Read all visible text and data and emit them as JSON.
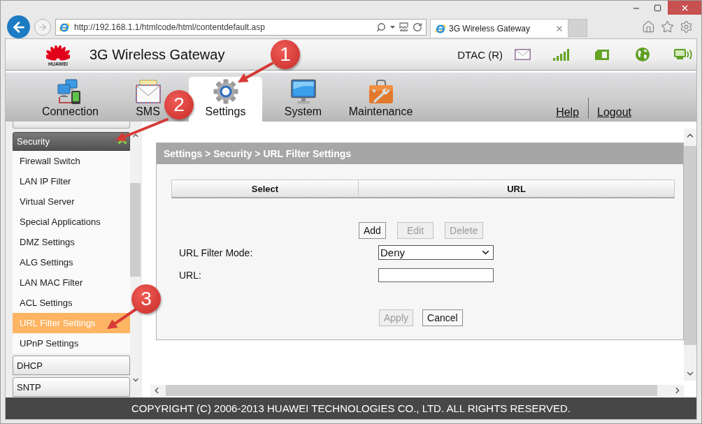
{
  "browser": {
    "url": "http://192.168.1.1/htmlcode/html/contentdefault.asp",
    "tabs": [
      {
        "title": "3G Wireless Gateway",
        "selected": true
      }
    ]
  },
  "header": {
    "logo_text": "HUAWEI",
    "title": "3G Wireless Gateway",
    "network": "DTAC (R)"
  },
  "nav": {
    "tabs": [
      {
        "label": "Connection",
        "kind": "connection",
        "selected": false
      },
      {
        "label": "SMS",
        "kind": "sms",
        "selected": false
      },
      {
        "label": "Settings",
        "kind": "settings",
        "selected": true
      },
      {
        "label": "System",
        "kind": "system",
        "selected": false
      },
      {
        "label": "Maintenance",
        "kind": "maintenance",
        "selected": false
      }
    ],
    "links": [
      "Help",
      "Logout"
    ]
  },
  "sidebar": {
    "groups": [
      {
        "label": "Security",
        "expanded": true,
        "children": [
          {
            "label": "Firewall Switch",
            "selected": false
          },
          {
            "label": "LAN IP Filter",
            "selected": false
          },
          {
            "label": "Virtual Server",
            "selected": false
          },
          {
            "label": "Special Applications",
            "selected": false
          },
          {
            "label": "DMZ Settings",
            "selected": false
          },
          {
            "label": "ALG Settings",
            "selected": false
          },
          {
            "label": "LAN MAC Filter",
            "selected": false
          },
          {
            "label": "ACL Settings",
            "selected": false
          },
          {
            "label": "URL Filter Settings",
            "selected": true
          },
          {
            "label": "UPnP Settings",
            "selected": false
          }
        ]
      },
      {
        "label": "DHCP",
        "expanded": false
      },
      {
        "label": "SNTP",
        "expanded": false
      }
    ]
  },
  "panel": {
    "breadcrumb": "Settings > Security > URL Filter Settings",
    "table": {
      "columns": [
        "Select",
        "URL"
      ]
    },
    "actions": [
      {
        "label": "Add",
        "disabled": false
      },
      {
        "label": "Edit",
        "disabled": true
      },
      {
        "label": "Delete",
        "disabled": true
      }
    ],
    "fields": [
      {
        "label": "URL Filter Mode:",
        "kind": "select",
        "value": "Deny"
      },
      {
        "label": "URL:",
        "kind": "text"
      }
    ],
    "buttons": [
      {
        "label": "Apply",
        "disabled": true
      },
      {
        "label": "Cancel",
        "disabled": false
      }
    ]
  },
  "footer": {
    "copyright": "COPYRIGHT (C) 2006-2013 HUAWEI TECHNOLOGIES CO., LTD. ALL RIGHTS RESERVED."
  },
  "annotations": [
    {
      "number": "1"
    },
    {
      "number": "2"
    },
    {
      "number": "3"
    }
  ]
}
